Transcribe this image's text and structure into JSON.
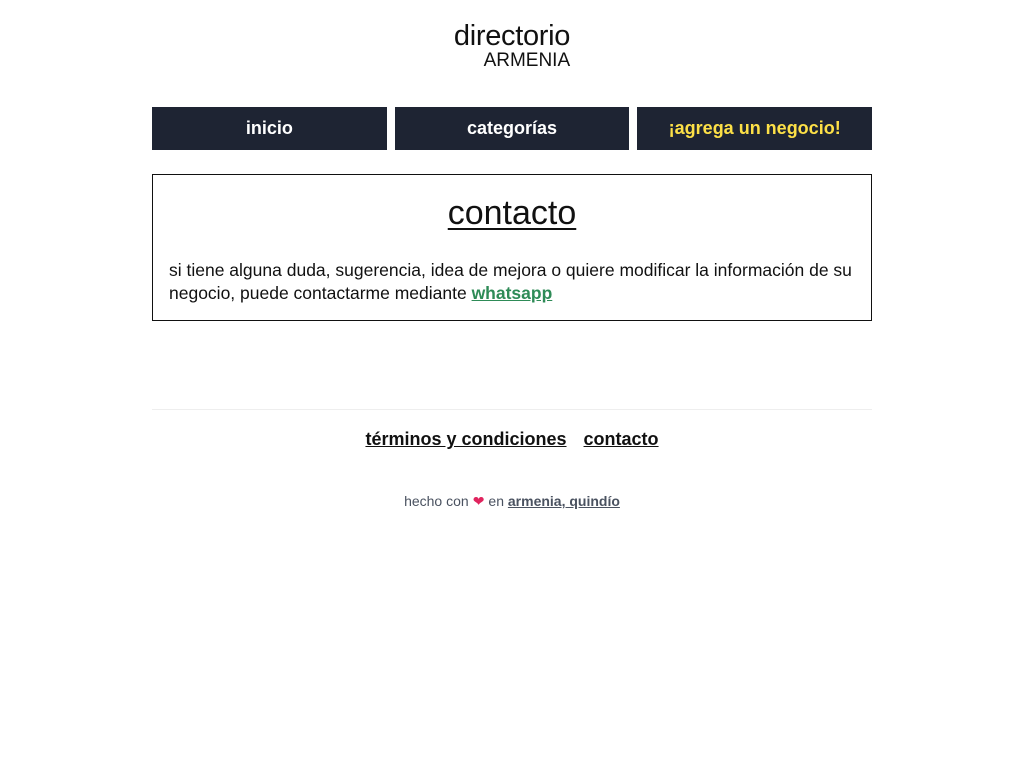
{
  "header": {
    "logo_title": "directorio",
    "logo_subtitle": "ARMENIA"
  },
  "nav": {
    "home_label": "inicio",
    "categories_label": "categorías",
    "add_business_label": "¡agrega un negocio!"
  },
  "contact": {
    "title": "contacto",
    "body_text": "si tiene alguna duda, sugerencia, idea de mejora o quiere modificar la información de su negocio, puede contactarme mediante ",
    "whatsapp_label": "whatsapp"
  },
  "footer": {
    "terms_label": "términos y condiciones",
    "contact_label": "contacto",
    "credit_prefix": "hecho con",
    "heart": "❤",
    "credit_middle": "en",
    "credit_link": "armenia, quindío"
  },
  "colors": {
    "nav_bg": "#1e2433",
    "accent_yellow": "#fde047",
    "whatsapp_green": "#2e8b57",
    "heart_red": "#e0245e"
  }
}
